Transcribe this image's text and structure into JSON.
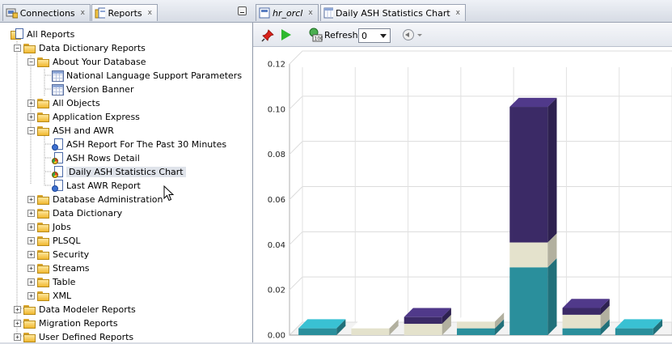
{
  "left_tabs": [
    {
      "label": "Connections",
      "close": "x"
    },
    {
      "label": "Reports",
      "close": "x"
    }
  ],
  "tree": {
    "root": "All Reports",
    "data_dictionary_reports": "Data Dictionary Reports",
    "about_your_database": "About Your Database",
    "nls_params": "National Language Support Parameters",
    "version_banner": "Version Banner",
    "all_objects": "All Objects",
    "application_express": "Application Express",
    "ash_and_awr": "ASH and AWR",
    "ash_report_30": "ASH Report For The Past 30 Minutes",
    "ash_rows_detail": "ASH Rows Detail",
    "daily_ash_chart": "Daily ASH Statistics Chart",
    "last_awr_report": "Last AWR Report",
    "database_administration": "Database Administration",
    "data_dictionary": "Data Dictionary",
    "jobs": "Jobs",
    "plsql": "PLSQL",
    "security": "Security",
    "streams": "Streams",
    "table": "Table",
    "xml": "XML",
    "data_modeler_reports": "Data Modeler Reports",
    "migration_reports": "Migration Reports",
    "user_defined_reports": "User Defined Reports"
  },
  "right_tabs": [
    {
      "label": "hr_orcl",
      "close": "x"
    },
    {
      "label": "Daily ASH Statistics Chart",
      "close": "x"
    }
  ],
  "toolbar": {
    "refresh_label": "Refresh:",
    "refresh_value": "0"
  },
  "colors": {
    "teal": "#2a8f9c",
    "cream": "#e4e2cc",
    "purple": "#3b2a66",
    "lavender": "#a99bc0",
    "light_teal": "#a8d4dc"
  },
  "chart_data": {
    "type": "bar",
    "stacked": true,
    "three_d": true,
    "ylim": [
      0,
      0.12
    ],
    "yticks": [
      "0.12",
      "0.10",
      "0.08",
      "0.06",
      "0.04",
      "0.02",
      "0.00"
    ],
    "ytick_values": [
      0.12,
      0.1,
      0.08,
      0.06,
      0.04,
      0.02,
      0.0
    ],
    "grid": true,
    "legend": "none",
    "bars": [
      {
        "segments": [
          {
            "color": "teal",
            "value": 0.003
          }
        ]
      },
      {
        "segments": [
          {
            "color": "cream",
            "value": 0.003
          }
        ]
      },
      {
        "segments": [
          {
            "color": "cream",
            "value": 0.005
          },
          {
            "color": "purple",
            "value": 0.003
          }
        ]
      },
      {
        "segments": [
          {
            "color": "teal",
            "value": 0.003
          },
          {
            "color": "cream",
            "value": 0.003
          }
        ]
      },
      {
        "segments": [
          {
            "color": "teal",
            "value": 0.03
          },
          {
            "color": "cream",
            "value": 0.011
          },
          {
            "color": "purple",
            "value": 0.06
          }
        ]
      },
      {
        "segments": [
          {
            "color": "teal",
            "value": 0.003
          },
          {
            "color": "cream",
            "value": 0.006
          },
          {
            "color": "purple",
            "value": 0.003
          }
        ]
      },
      {
        "segments": [
          {
            "color": "teal",
            "value": 0.003
          }
        ]
      }
    ]
  }
}
